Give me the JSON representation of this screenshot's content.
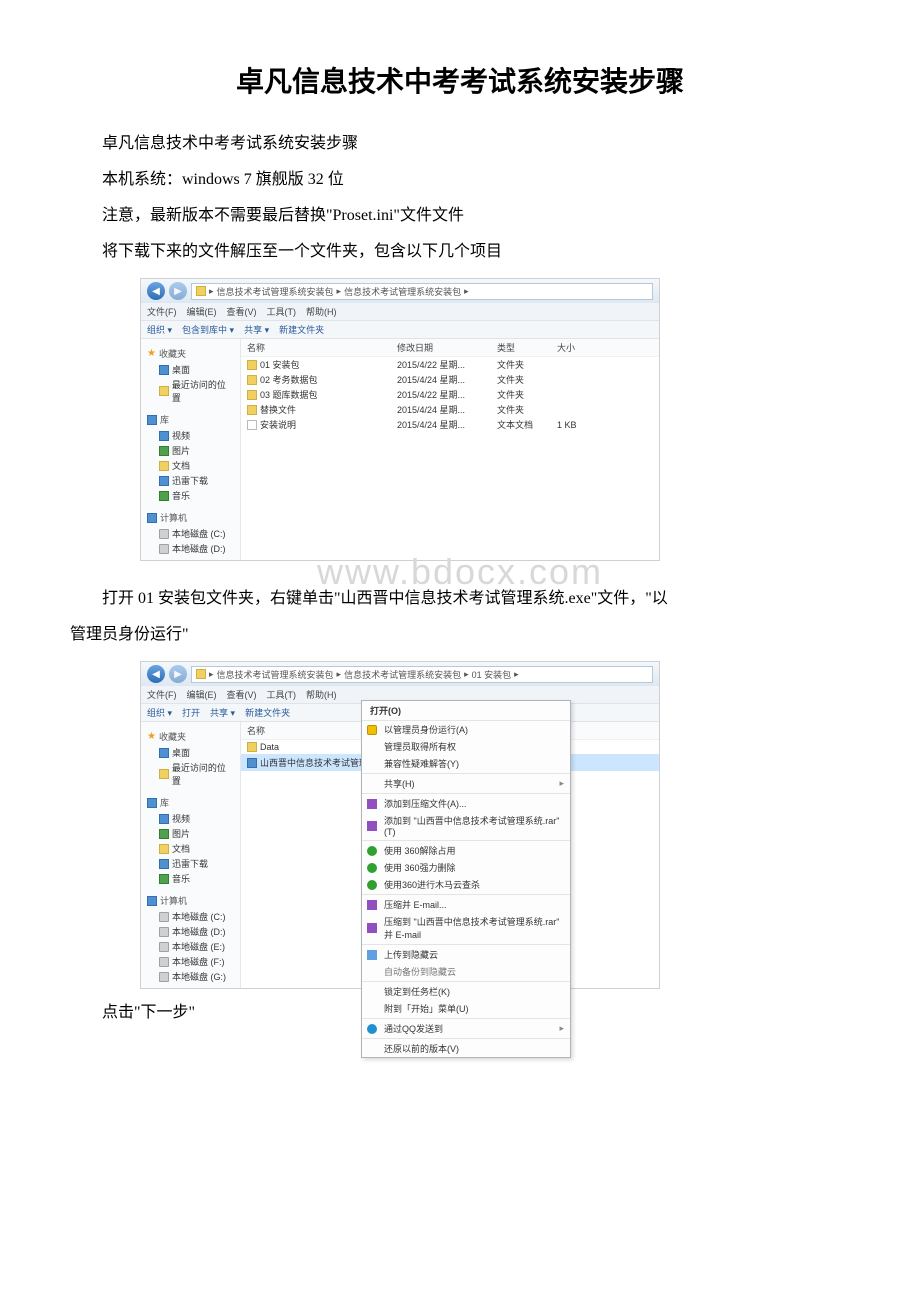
{
  "title": "卓凡信息技术中考考试系统安装步骤",
  "paras": {
    "p1": "卓凡信息技术中考考试系统安装步骤",
    "p2": "本机系统：windows 7 旗舰版 32 位",
    "p3": "注意，最新版本不需要最后替换\"Proset.ini\"文件文件",
    "p4": "将下载下来的文件解压至一个文件夹，包含以下几个项目",
    "p5a": "打开 01 安装包文件夹，右键单击\"山西晋中信息技术考试管理系统.exe\"文件，\"以",
    "p5b": "管理员身份运行\"",
    "p6": "点击\"下一步\""
  },
  "watermark": "www.bdocx.com",
  "explorer1": {
    "breadcrumb": [
      "信息技术考试管理系统安装包",
      "信息技术考试管理系统安装包"
    ],
    "menu": [
      "文件(F)",
      "编辑(E)",
      "查看(V)",
      "工具(T)",
      "帮助(H)"
    ],
    "toolbar": [
      "组织 ▾",
      "包含到库中 ▾",
      "共享 ▾",
      "新建文件夹"
    ],
    "sidebar": {
      "fav_title": "收藏夹",
      "fav_items": [
        "桌面",
        "最近访问的位置"
      ],
      "lib_title": "库",
      "lib_items": [
        "视频",
        "图片",
        "文档",
        "迅雷下载",
        "音乐"
      ],
      "comp_title": "计算机",
      "comp_items": [
        "本地磁盘 (C:)",
        "本地磁盘 (D:)"
      ]
    },
    "columns": [
      "名称",
      "修改日期",
      "类型",
      "大小"
    ],
    "rows": [
      {
        "name": "01 安装包",
        "date": "2015/4/22 星期...",
        "type": "文件夹",
        "size": ""
      },
      {
        "name": "02 考务数据包",
        "date": "2015/4/24 星期...",
        "type": "文件夹",
        "size": ""
      },
      {
        "name": "03 题库数据包",
        "date": "2015/4/22 星期...",
        "type": "文件夹",
        "size": ""
      },
      {
        "name": "替换文件",
        "date": "2015/4/24 星期...",
        "type": "文件夹",
        "size": ""
      },
      {
        "name": "安装说明",
        "date": "2015/4/24 星期...",
        "type": "文本文档",
        "size": "1 KB"
      }
    ]
  },
  "explorer2": {
    "breadcrumb": [
      "信息技术考试管理系统安装包",
      "信息技术考试管理系统安装包",
      "01 安装包"
    ],
    "menu": [
      "文件(F)",
      "编辑(E)",
      "查看(V)",
      "工具(T)",
      "帮助(H)"
    ],
    "toolbar": [
      "组织 ▾",
      "打开",
      "共享 ▾",
      "新建文件夹"
    ],
    "sidebar": {
      "fav_title": "收藏夹",
      "fav_items": [
        "桌面",
        "最近访问的位置"
      ],
      "lib_title": "库",
      "lib_items": [
        "视频",
        "图片",
        "文档",
        "迅雷下载",
        "音乐"
      ],
      "comp_title": "计算机",
      "comp_items": [
        "本地磁盘 (C:)",
        "本地磁盘 (D:)",
        "本地磁盘 (E:)",
        "本地磁盘 (F:)",
        "本地磁盘 (G:)"
      ]
    },
    "col_name": "名称",
    "files": [
      "Data",
      "山西晋中信息技术考试管理"
    ],
    "ctx": {
      "open": "打开(O)",
      "items": [
        "以管理员身份运行(A)",
        "管理员取得所有权",
        "兼容性疑难解答(Y)",
        "共享(H)",
        "添加到压缩文件(A)...",
        "添加到 \"山西晋中信息技术考试管理系统.rar\"(T)",
        "使用 360解除占用",
        "使用 360强力删除",
        "使用360进行木马云查杀",
        "压缩并 E-mail...",
        "压缩到 \"山西晋中信息技术考试管理系统.rar\" 并 E-mail",
        "上传到隐藏云",
        "自动备份到隐藏云",
        "锁定到任务栏(K)",
        "附到「开始」菜单(U)",
        "通过QQ发送到",
        "还原以前的版本(V)"
      ]
    }
  }
}
